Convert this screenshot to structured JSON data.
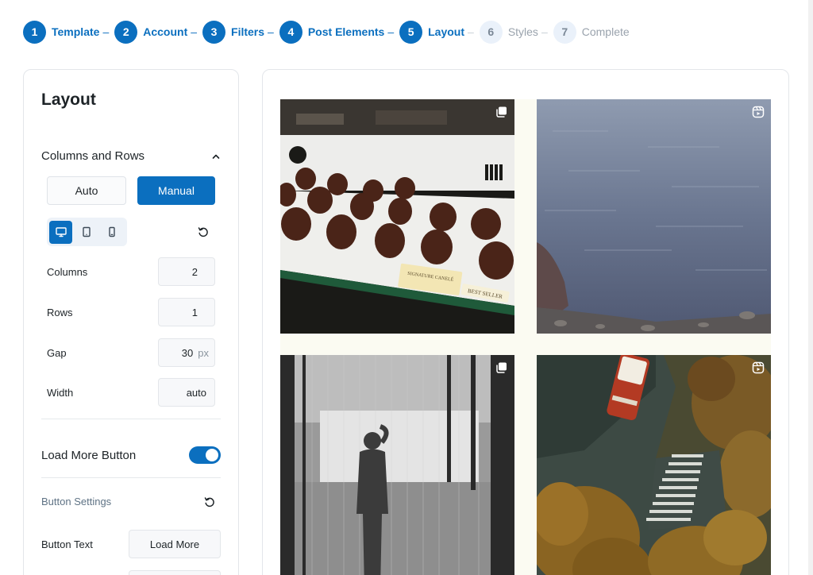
{
  "stepper": {
    "steps": [
      {
        "num": "1",
        "label": "Template"
      },
      {
        "num": "2",
        "label": "Account"
      },
      {
        "num": "3",
        "label": "Filters"
      },
      {
        "num": "4",
        "label": "Post Elements"
      },
      {
        "num": "5",
        "label": "Layout"
      },
      {
        "num": "6",
        "label": "Styles"
      },
      {
        "num": "7",
        "label": "Complete"
      }
    ],
    "separator": "–",
    "active_step": "5"
  },
  "layout_panel": {
    "title": "Layout",
    "columns_rows": {
      "title": "Columns and Rows",
      "mode_auto": "Auto",
      "mode_manual": "Manual",
      "selected_mode": "Manual",
      "devices": [
        "desktop-icon",
        "tablet-icon",
        "mobile-icon"
      ],
      "active_device": "desktop",
      "fields": {
        "columns": {
          "label": "Columns",
          "value": "2"
        },
        "rows": {
          "label": "Rows",
          "value": "1"
        },
        "gap": {
          "label": "Gap",
          "value": "30",
          "unit": "px"
        },
        "width": {
          "label": "Width",
          "value": "auto"
        }
      }
    },
    "load_more": {
      "label": "Load More Button",
      "enabled": true,
      "settings_label": "Button Settings",
      "button_text_label": "Button Text",
      "button_text_value": "Load More"
    }
  },
  "preview": {
    "tiles": [
      {
        "type": "carousel",
        "icon": "multiple-images-icon",
        "caption": "SIGNATURE CANELÉ",
        "badge": "BEST SELLER"
      },
      {
        "type": "reel",
        "icon": "reel-icon"
      },
      {
        "type": "carousel",
        "icon": "multiple-images-icon"
      },
      {
        "type": "reel",
        "icon": "reel-icon"
      }
    ]
  },
  "colors": {
    "accent": "#0b6fbf",
    "muted_step": "#eaf1fa",
    "preview_bg": "#fbfbf2"
  }
}
